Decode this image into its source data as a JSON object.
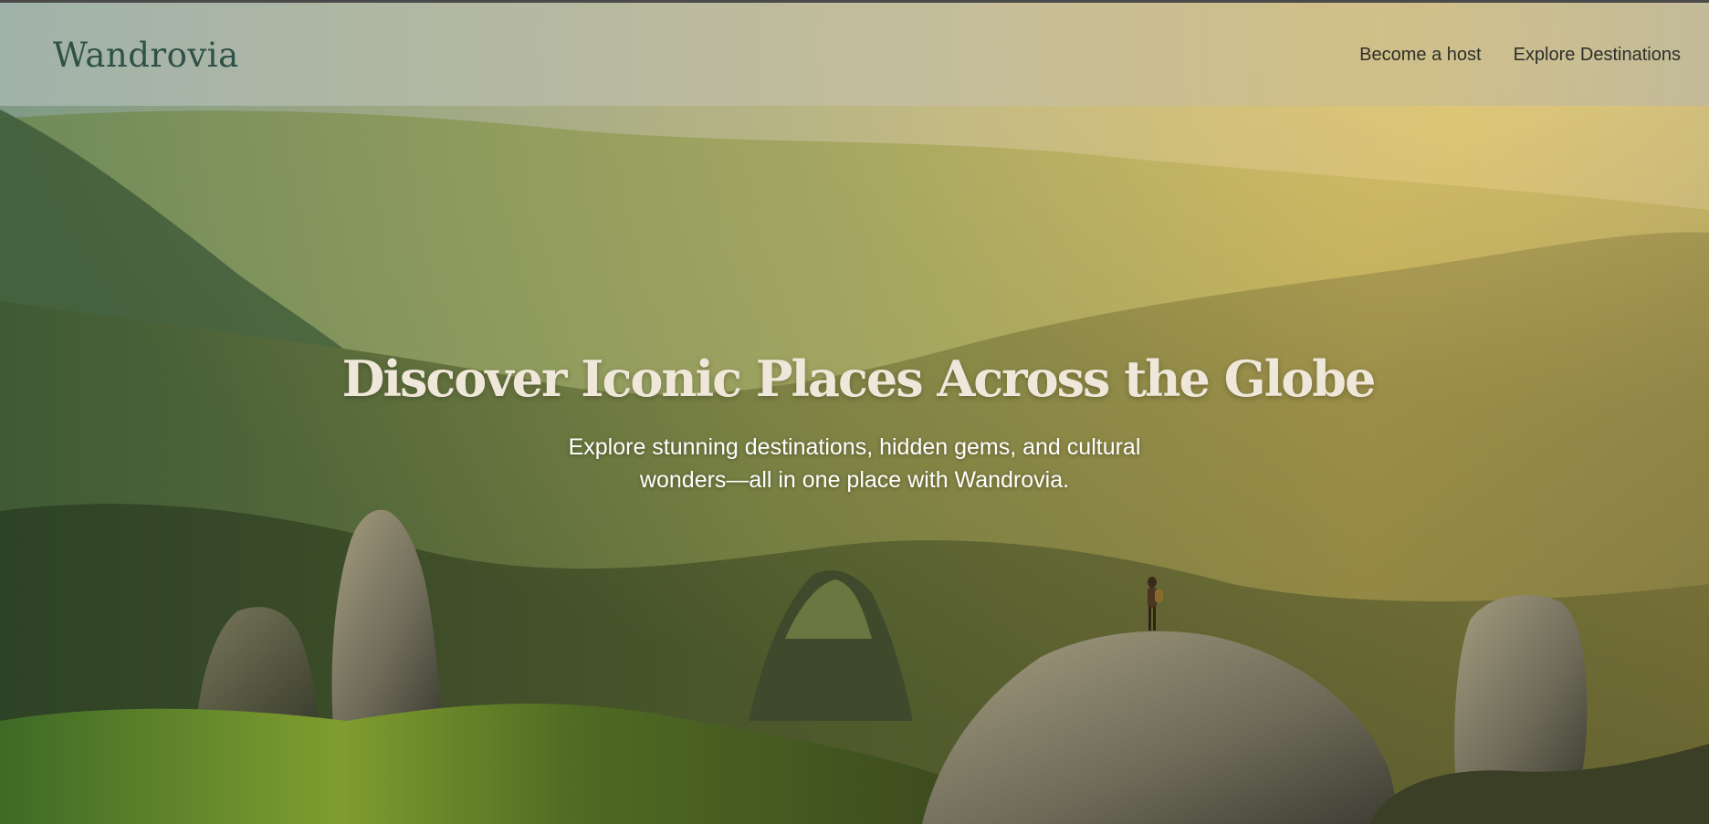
{
  "header": {
    "logo": "Wandrovia",
    "nav": [
      {
        "label": "Become a host"
      },
      {
        "label": "Explore Destinations"
      }
    ]
  },
  "hero": {
    "title": "Discover Iconic Places Across the Globe",
    "subtitle": "Explore stunning destinations, hidden gems, and cultural wonders—all in one place with Wandrovia."
  },
  "colors": {
    "logo": "#2f5148",
    "nav_text": "#2e2f2a",
    "hero_title": "#efe8da",
    "hero_subtitle": "#ffffff"
  }
}
